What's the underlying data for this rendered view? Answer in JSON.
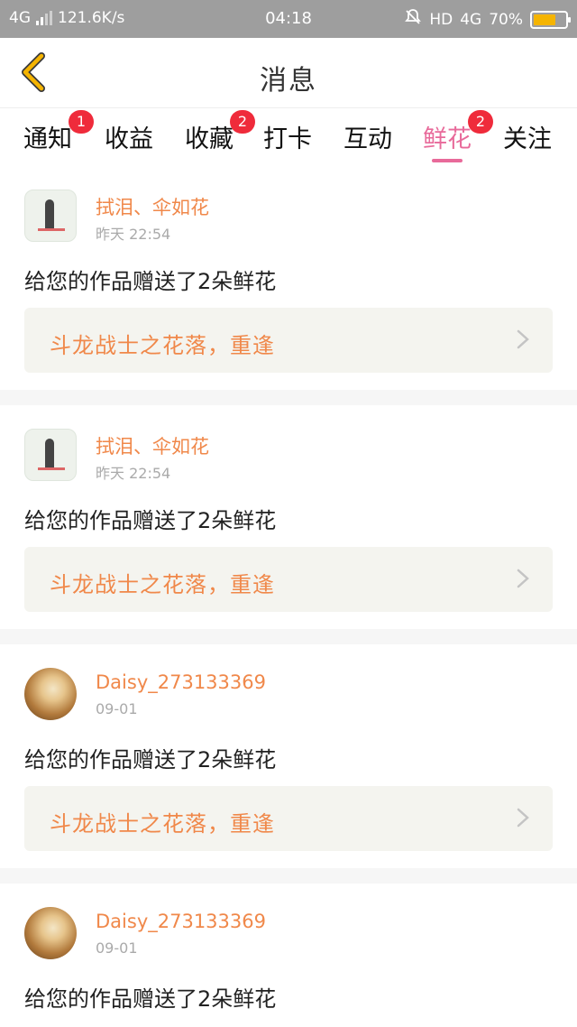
{
  "status_bar": {
    "network": "4G",
    "speed": "121.6K/s",
    "time": "04:18",
    "hd": "HD",
    "network_right": "4G",
    "battery": "70%",
    "battery_level": 0.7
  },
  "header": {
    "title": "消息"
  },
  "tabs": [
    {
      "label": "通知",
      "badge": "1",
      "active": false
    },
    {
      "label": "收益",
      "badge": "",
      "active": false
    },
    {
      "label": "收藏",
      "badge": "2",
      "active": false
    },
    {
      "label": "打卡",
      "badge": "",
      "active": false
    },
    {
      "label": "互动",
      "badge": "",
      "active": false
    },
    {
      "label": "鲜花",
      "badge": "2",
      "active": true
    },
    {
      "label": "关注",
      "badge": "",
      "active": false
    }
  ],
  "messages": [
    {
      "user": "拭泪、伞如花",
      "time": "昨天 22:54",
      "text": "给您的作品赠送了2朵鲜花",
      "work": "斗龙战士之花落，重逢",
      "avatar": "pic"
    },
    {
      "user": "拭泪、伞如花",
      "time": "昨天 22:54",
      "text": "给您的作品赠送了2朵鲜花",
      "work": "斗龙战士之花落，重逢",
      "avatar": "pic"
    },
    {
      "user": "Daisy_273133369",
      "time": "09-01",
      "text": "给您的作品赠送了2朵鲜花",
      "work": "斗龙战士之花落，重逢",
      "avatar": "photo"
    },
    {
      "user": "Daisy_273133369",
      "time": "09-01",
      "text": "给您的作品赠送了2朵鲜花",
      "work": "",
      "avatar": "photo"
    }
  ],
  "colors": {
    "accent": "#e86a9a",
    "name": "#f0884a",
    "badge": "#ef2b3b",
    "back_arrow": "#f5b400"
  }
}
